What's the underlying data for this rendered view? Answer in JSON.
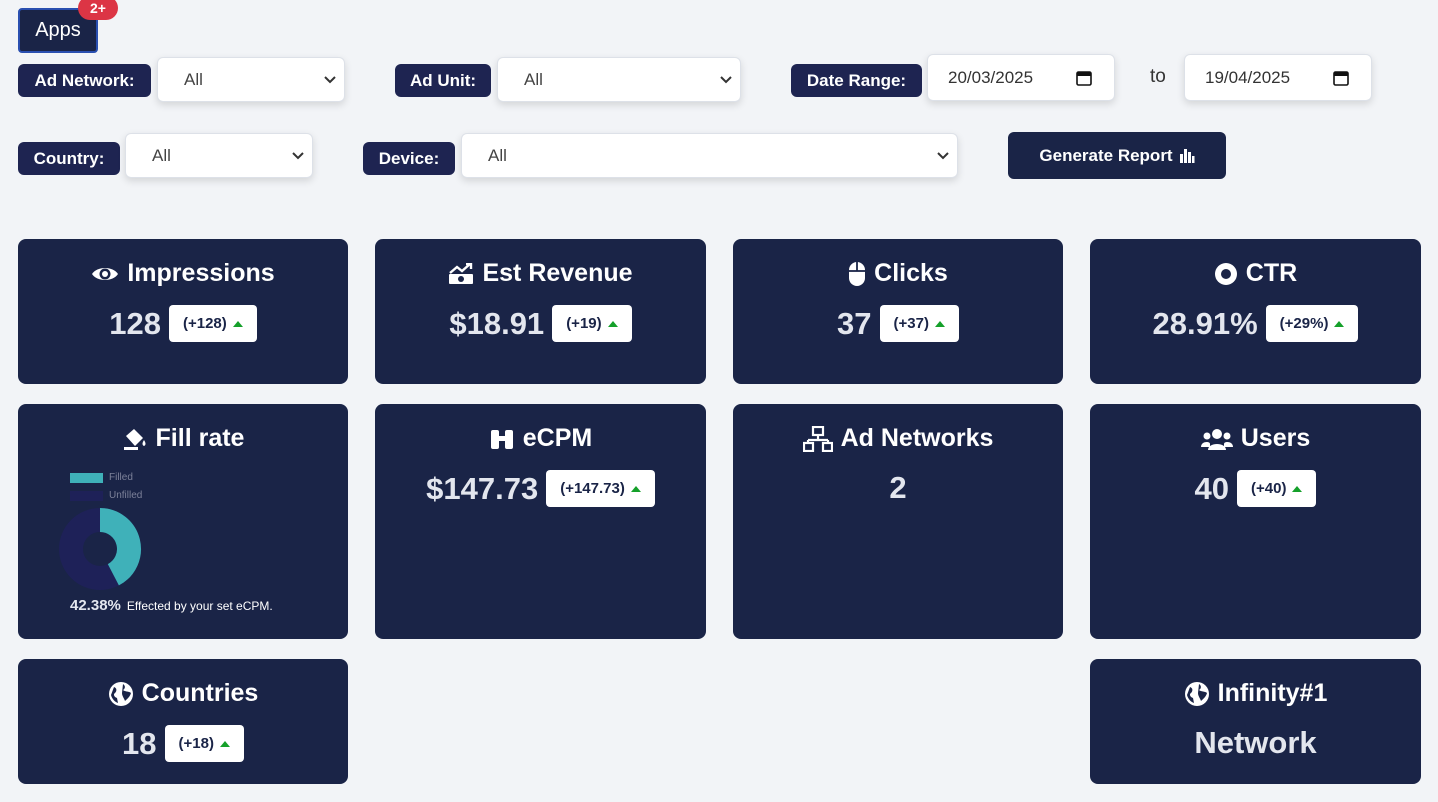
{
  "apps": {
    "label": "Apps",
    "badge": "2+"
  },
  "filters": {
    "ad_network": {
      "label": "Ad Network:",
      "value": "All"
    },
    "ad_unit": {
      "label": "Ad Unit:",
      "value": "All"
    },
    "date_range": {
      "label": "Date Range:",
      "from": "20/03/2025",
      "to_label": "to",
      "to": "19/04/2025"
    },
    "country": {
      "label": "Country:",
      "value": "All"
    },
    "device": {
      "label": "Device:",
      "value": "All"
    },
    "generate_label": "Generate Report"
  },
  "cards": {
    "impressions": {
      "title": "Impressions",
      "value": "128",
      "delta": "(+128)"
    },
    "revenue": {
      "title": "Est Revenue",
      "value": "$18.91",
      "delta": "(+19)"
    },
    "clicks": {
      "title": "Clicks",
      "value": "37",
      "delta": "(+37)"
    },
    "ctr": {
      "title": "CTR",
      "value": "28.91%",
      "delta": "(+29%)"
    },
    "fill_rate": {
      "title": "Fill rate",
      "legend_filled": "Filled",
      "legend_unfilled": "Unfilled",
      "percent": "42.38%",
      "note": "Effected by your set eCPM.",
      "filled_fraction": 0.4238,
      "filled_color": "#3fb1b9",
      "unfilled_color": "#1e2158"
    },
    "ecpm": {
      "title": "eCPM",
      "value": "$147.73",
      "delta": "(+147.73)"
    },
    "ad_networks": {
      "title": "Ad Networks",
      "value": "2"
    },
    "users": {
      "title": "Users",
      "value": "40",
      "delta": "(+40)"
    },
    "countries": {
      "title": "Countries",
      "value": "18",
      "delta": "(+18)"
    },
    "infinity": {
      "title": "Infinity#1",
      "value": "Network"
    }
  },
  "colors": {
    "navy": "#1a2447",
    "label_bg": "#1e2451",
    "badge": "#dc3545",
    "up_arrow": "#15a02a"
  }
}
